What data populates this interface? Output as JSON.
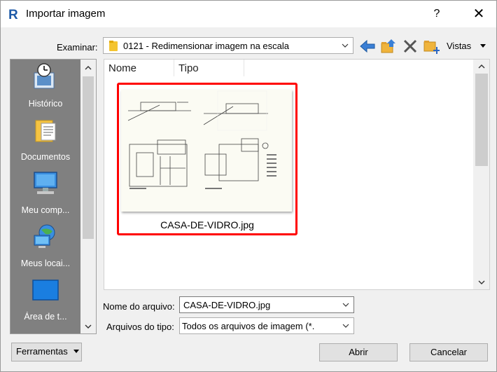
{
  "window": {
    "title": "Importar imagem",
    "help_label": "?",
    "close_label": "✕"
  },
  "toolbar": {
    "look_in_label": "Examinar:",
    "look_in_value": "0121 - Redimensionar imagem na escala",
    "views_label": "Vistas",
    "icons": [
      "back-arrow-icon",
      "up-folder-icon",
      "delete-icon",
      "new-folder-icon",
      "views-dropdown-icon"
    ]
  },
  "places": [
    {
      "label": "Histórico",
      "icon": "history-icon"
    },
    {
      "label": "Documentos",
      "icon": "documents-icon"
    },
    {
      "label": "Meu comp...",
      "icon": "my-computer-icon"
    },
    {
      "label": "Meus locai...",
      "icon": "network-places-icon"
    },
    {
      "label": "Área de t...",
      "icon": "desktop-icon"
    }
  ],
  "filelist": {
    "columns": [
      "Nome",
      "Tipo"
    ],
    "items": [
      {
        "name": "CASA-DE-VIDRO.jpg",
        "selected": true
      }
    ]
  },
  "fields": {
    "filename_label": "Nome do arquivo:",
    "filename_value": "CASA-DE-VIDRO.jpg",
    "filetype_label": "Arquivos do tipo:",
    "filetype_value": "Todos os arquivos de imagem (*."
  },
  "buttons": {
    "tools_label": "Ferramentas",
    "open_label": "Abrir",
    "cancel_label": "Cancelar"
  },
  "colors": {
    "selection_border": "#ff0000",
    "places_bg": "#808080",
    "app_icon": "#1e5aa8"
  }
}
